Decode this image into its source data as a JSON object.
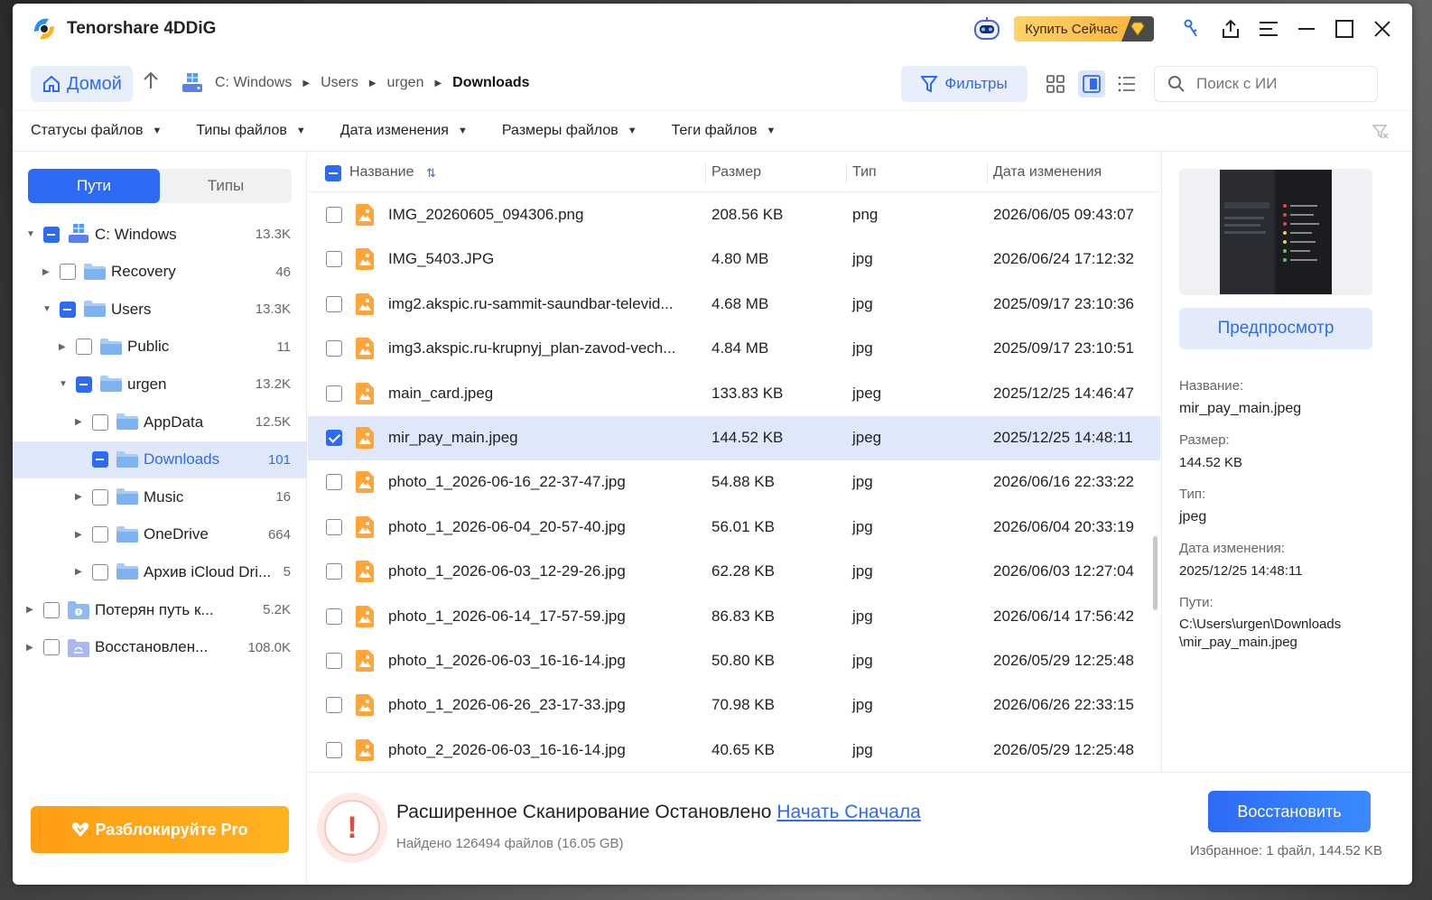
{
  "app": {
    "title": "Tenorshare 4DDiG"
  },
  "titlebar": {
    "buy_label": "Купить Сейчас"
  },
  "nav": {
    "home_label": "Домой",
    "breadcrumb": [
      "C: Windows",
      "Users",
      "urgen",
      "Downloads"
    ],
    "filters_label": "Фильтры",
    "search_placeholder": "Поиск с ИИ"
  },
  "filters": [
    "Статусы файлов",
    "Типы файлов",
    "Дата изменения",
    "Размеры файлов",
    "Теги файлов"
  ],
  "sidebar": {
    "tabs": [
      "Пути",
      "Типы"
    ],
    "tree": [
      {
        "label": "C: Windows",
        "count": "13.3K",
        "level": 0,
        "expanded": true,
        "check": "partial"
      },
      {
        "label": "Recovery",
        "count": "46",
        "level": 1,
        "expanded": false,
        "check": "none"
      },
      {
        "label": "Users",
        "count": "13.3K",
        "level": 1,
        "expanded": true,
        "check": "partial"
      },
      {
        "label": "Public",
        "count": "11",
        "level": 2,
        "expanded": false,
        "check": "none"
      },
      {
        "label": "urgen",
        "count": "13.2K",
        "level": 2,
        "expanded": true,
        "check": "partial"
      },
      {
        "label": "AppData",
        "count": "12.5K",
        "level": 3,
        "expanded": false,
        "check": "none"
      },
      {
        "label": "Downloads",
        "count": "101",
        "level": 3,
        "expanded": null,
        "check": "partial",
        "selected": true
      },
      {
        "label": "Music",
        "count": "16",
        "level": 3,
        "expanded": false,
        "check": "none"
      },
      {
        "label": "OneDrive",
        "count": "664",
        "level": 3,
        "expanded": false,
        "check": "none"
      },
      {
        "label": "Архив iCloud Dri...",
        "count": "5",
        "level": 3,
        "expanded": false,
        "check": "none"
      },
      {
        "label": "Потерян путь к...",
        "count": "5.2K",
        "level": 0,
        "expanded": false,
        "check": "none",
        "special": "lost"
      },
      {
        "label": "Восстановлен...",
        "count": "108.0K",
        "level": 0,
        "expanded": false,
        "check": "none",
        "special": "recovered"
      }
    ],
    "unlock_label": "Разблокируйте Pro"
  },
  "table": {
    "headers": {
      "name": "Название",
      "size": "Размер",
      "type": "Тип",
      "date": "Дата изменения"
    },
    "rows": [
      {
        "name": "IMG_20260605_094306.png",
        "size": "208.56 KB",
        "type": "png",
        "date": "2026/06/05 09:43:07",
        "checked": false
      },
      {
        "name": "IMG_5403.JPG",
        "size": "4.80 MB",
        "type": "jpg",
        "date": "2026/06/24 17:12:32",
        "checked": false
      },
      {
        "name": "img2.akspic.ru-sammit-saundbar-televid...",
        "size": "4.68 MB",
        "type": "jpg",
        "date": "2025/09/17 23:10:36",
        "checked": false
      },
      {
        "name": "img3.akspic.ru-krupnyj_plan-zavod-vech...",
        "size": "4.84 MB",
        "type": "jpg",
        "date": "2025/09/17 23:10:51",
        "checked": false
      },
      {
        "name": "main_card.jpeg",
        "size": "133.83 KB",
        "type": "jpeg",
        "date": "2025/12/25 14:46:47",
        "checked": false
      },
      {
        "name": "mir_pay_main.jpeg",
        "size": "144.52 KB",
        "type": "jpeg",
        "date": "2025/12/25 14:48:11",
        "checked": true
      },
      {
        "name": "photo_1_2026-06-16_22-37-47.jpg",
        "size": "54.88 KB",
        "type": "jpg",
        "date": "2026/06/16 22:33:22",
        "checked": false
      },
      {
        "name": "photo_1_2026-06-04_20-57-40.jpg",
        "size": "56.01 KB",
        "type": "jpg",
        "date": "2026/06/04 20:33:19",
        "checked": false
      },
      {
        "name": "photo_1_2026-06-03_12-29-26.jpg",
        "size": "62.28 KB",
        "type": "jpg",
        "date": "2026/06/03 12:27:04",
        "checked": false
      },
      {
        "name": "photo_1_2026-06-14_17-57-59.jpg",
        "size": "86.83 KB",
        "type": "jpg",
        "date": "2026/06/14 17:56:42",
        "checked": false
      },
      {
        "name": "photo_1_2026-06-03_16-16-14.jpg",
        "size": "50.80 KB",
        "type": "jpg",
        "date": "2026/05/29 12:25:48",
        "checked": false
      },
      {
        "name": "photo_1_2026-06-26_23-17-33.jpg",
        "size": "70.98 KB",
        "type": "jpg",
        "date": "2026/06/26 22:33:15",
        "checked": false
      },
      {
        "name": "photo_2_2026-06-03_16-16-14.jpg",
        "size": "40.65 KB",
        "type": "jpg",
        "date": "2026/05/29 12:25:48",
        "checked": false
      }
    ]
  },
  "details": {
    "preview_label": "Предпросмотр",
    "name_label": "Название:",
    "name_value": "mir_pay_main.jpeg",
    "size_label": "Размер:",
    "size_value": "144.52 KB",
    "type_label": "Тип:",
    "type_value": "jpeg",
    "date_label": "Дата изменения:",
    "date_value": "2025/12/25 14:48:11",
    "path_label": "Пути:",
    "path_value_1": "C:\\Users\\urgen\\Downloads",
    "path_value_2": "\\mir_pay_main.jpeg"
  },
  "status": {
    "title": "Расширенное Сканирование Остановлено",
    "restart_link": "Начать Сначала",
    "found": "Найдено 126494 файлов (16.05 GB)",
    "restore_label": "Восстановить",
    "favorites": "Избранное: 1 файл, 144.52 KB"
  },
  "colors": {
    "accent": "#2d6bf5",
    "selected_bg": "#dfe8fb",
    "unlock_orange": "#ff9d14",
    "warning_red": "#e8453c"
  }
}
